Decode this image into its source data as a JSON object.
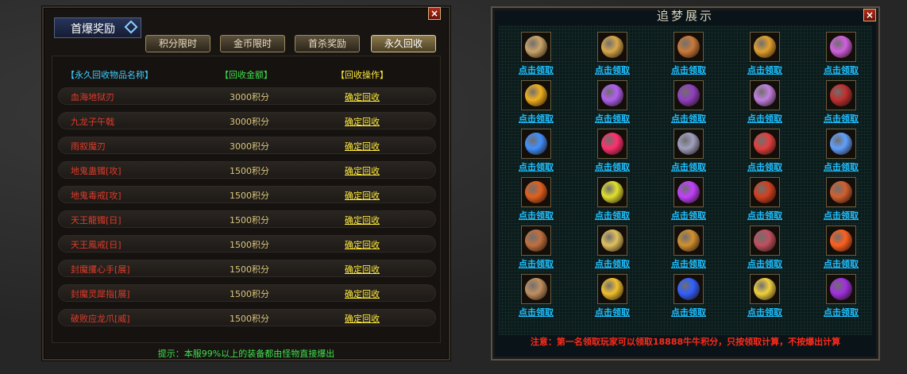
{
  "left_panel": {
    "title": "首爆奖励",
    "tabs": [
      "积分限时",
      "金币限时",
      "首杀奖励",
      "永久回收"
    ],
    "active_tab": 3,
    "headers": {
      "name": "【永久回收物品名称】",
      "amount": "【回收金额】",
      "action": "【回收操作】"
    },
    "rows": [
      {
        "name": "血海地狱刃",
        "amount": "3000积分",
        "action": "确定回收"
      },
      {
        "name": "九龙子午戟",
        "amount": "3000积分",
        "action": "确定回收"
      },
      {
        "name": "雨叙魔刃",
        "amount": "3000积分",
        "action": "确定回收"
      },
      {
        "name": "地鬼蛊镯[攻]",
        "amount": "1500积分",
        "action": "确定回收"
      },
      {
        "name": "地鬼毒戒[攻]",
        "amount": "1500积分",
        "action": "确定回收"
      },
      {
        "name": "天王龍镯[日]",
        "amount": "1500积分",
        "action": "确定回收"
      },
      {
        "name": "天王鳳戒[日]",
        "amount": "1500积分",
        "action": "确定回收"
      },
      {
        "name": "封魔攫心手[展]",
        "amount": "1500积分",
        "action": "确定回收"
      },
      {
        "name": "封魔灵犀指[展]",
        "amount": "1500积分",
        "action": "确定回收"
      },
      {
        "name": "破败应龙爪[威]",
        "amount": "1500积分",
        "action": "确定回收"
      }
    ],
    "tip": "提示：本服99%以上的装备都由怪物直接爆出"
  },
  "right_panel": {
    "title": "追梦展示",
    "claim_label": "点击领取",
    "icons": [
      "#c9a46a",
      "#d7a84b",
      "#c97a3a",
      "#e0a030",
      "#d060e0",
      "#f0b020",
      "#b060f0",
      "#9040c0",
      "#c080e0",
      "#c03030",
      "#4090ff",
      "#ff3070",
      "#a0a0c0",
      "#e04040",
      "#60a0ff",
      "#e06020",
      "#e0e030",
      "#c040ff",
      "#d04020",
      "#d06030",
      "#c07040",
      "#e0c060",
      "#d09030",
      "#c05060",
      "#ff6020",
      "#c09060",
      "#f0c030",
      "#3060ff",
      "#f0d040",
      "#a030e0"
    ],
    "note": "注意：第一名领取玩家可以领取18888牛牛积分，只按领取计算，不按爆出计算"
  }
}
